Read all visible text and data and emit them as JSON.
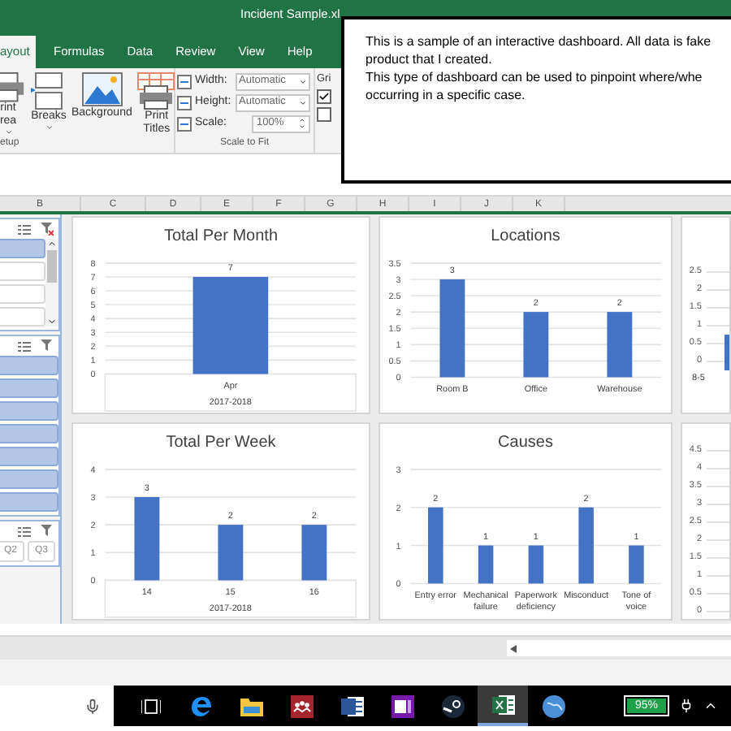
{
  "window": {
    "title": "Incident Sample.xl"
  },
  "ribbon_tabs": [
    {
      "label": "ayout",
      "selected": true
    },
    {
      "label": "Formulas",
      "selected": false
    },
    {
      "label": "Data",
      "selected": false
    },
    {
      "label": "Review",
      "selected": false
    },
    {
      "label": "View",
      "selected": false
    },
    {
      "label": "Help",
      "selected": false
    }
  ],
  "page_setup": {
    "buttons": [
      {
        "kind": "printer",
        "lines": [
          "rint",
          "rea"
        ],
        "dropdown": true
      },
      {
        "kind": "breaks",
        "lines": [
          "Breaks"
        ],
        "dropdown": true
      },
      {
        "kind": "background",
        "lines": [
          "Background"
        ],
        "dropdown": false
      },
      {
        "kind": "titles",
        "lines": [
          "Print",
          "Titles"
        ],
        "dropdown": false
      }
    ],
    "group_label": "etup"
  },
  "scale_to_fit": {
    "rows": [
      {
        "kind": "dropdown",
        "label": "Width:",
        "value": "Automatic"
      },
      {
        "kind": "dropdown",
        "label": "Height:",
        "value": "Automatic"
      },
      {
        "kind": "spinner",
        "label": "Scale:",
        "value": "100%"
      }
    ],
    "group_label": "Scale to Fit"
  },
  "sheet_options": {
    "label": "Gri",
    "checkboxes": [
      {
        "checked": true
      },
      {
        "checked": false
      }
    ]
  },
  "text_box": {
    "lines": [
      "This is a sample of an interactive dashboard. All data is fake",
      "product that I created.",
      "This type of dashboard can be used to pinpoint where/whe",
      "occurring in a specific case."
    ]
  },
  "column_headers": [
    "B",
    "C",
    "D",
    "E",
    "F",
    "G",
    "H",
    "I",
    "J",
    "K"
  ],
  "slicers": [
    {
      "items": [
        {
          "selected": true
        },
        {
          "selected": false
        },
        {
          "selected": false
        },
        {
          "selected": false
        }
      ],
      "scrollbar": true,
      "filtered": true
    },
    {
      "items": [
        {
          "selected": true
        },
        {
          "selected": true
        },
        {
          "selected": true
        },
        {
          "selected": true
        },
        {
          "selected": true
        },
        {
          "selected": true
        },
        {
          "selected": true
        }
      ],
      "scrollbar": false,
      "filtered": false
    },
    {
      "items": [
        {
          "label": "Q2",
          "selected": false
        },
        {
          "label": "Q3",
          "selected": false
        }
      ],
      "scrollbar": false,
      "filtered": false
    }
  ],
  "charts": [
    {
      "chart_data": {
        "type": "bar",
        "title": "Total Per Month",
        "categories": [
          "Apr"
        ],
        "values": [
          7
        ],
        "xlabel": "2017-2018",
        "yticks": [
          0,
          1,
          2,
          3,
          4,
          5,
          6,
          7,
          8
        ],
        "ylim": [
          0,
          8
        ],
        "data_labels": true,
        "grid": true
      }
    },
    {
      "chart_data": {
        "type": "bar",
        "title": "Locations",
        "categories": [
          "Room B",
          "Office",
          "Warehouse"
        ],
        "values": [
          3,
          2,
          2
        ],
        "yticks": [
          0,
          0.5,
          1,
          1.5,
          2,
          2.5,
          3,
          3.5
        ],
        "ylim": [
          0,
          3.5
        ],
        "data_labels": true,
        "grid": true
      }
    },
    {
      "chart_data": {
        "type": "bar",
        "title": "Total Per Week",
        "categories": [
          "14",
          "15",
          "16"
        ],
        "values": [
          3,
          2,
          2
        ],
        "xlabel": "2017-2018",
        "yticks": [
          0,
          1,
          2,
          3,
          4
        ],
        "ylim": [
          0,
          4
        ],
        "data_labels": true,
        "grid": true
      }
    },
    {
      "chart_data": {
        "type": "bar",
        "title": "Causes",
        "categories": [
          "Entry error",
          "Mechanical failure",
          "Paperwork deficiency",
          "Misconduct",
          "Tone of voice"
        ],
        "values": [
          2,
          1,
          1,
          2,
          1
        ],
        "yticks": [
          0,
          1,
          2,
          3
        ],
        "ylim": [
          0,
          3
        ],
        "data_labels": true,
        "grid": true
      }
    }
  ],
  "edge_charts": [
    {
      "axis_labels": [
        "2.5",
        "2",
        "1.5",
        "1",
        "0.5",
        "0"
      ],
      "category": "8-5",
      "bar": true
    },
    {
      "axis_labels": [
        "4.5",
        "4",
        "3.5",
        "3",
        "2.5",
        "2",
        "1.5",
        "1",
        "0.5",
        "0"
      ],
      "bar": false
    }
  ],
  "taskbar": {
    "apps": [
      {
        "kind": "taskview",
        "selected": false
      },
      {
        "kind": "edge",
        "selected": false
      },
      {
        "kind": "folder",
        "selected": false
      },
      {
        "kind": "red",
        "selected": false
      },
      {
        "kind": "word",
        "selected": false
      },
      {
        "kind": "onenote",
        "selected": false
      },
      {
        "kind": "steam",
        "selected": false
      },
      {
        "kind": "excel",
        "selected": true
      },
      {
        "kind": "globe",
        "selected": false
      }
    ],
    "battery": "95%"
  }
}
